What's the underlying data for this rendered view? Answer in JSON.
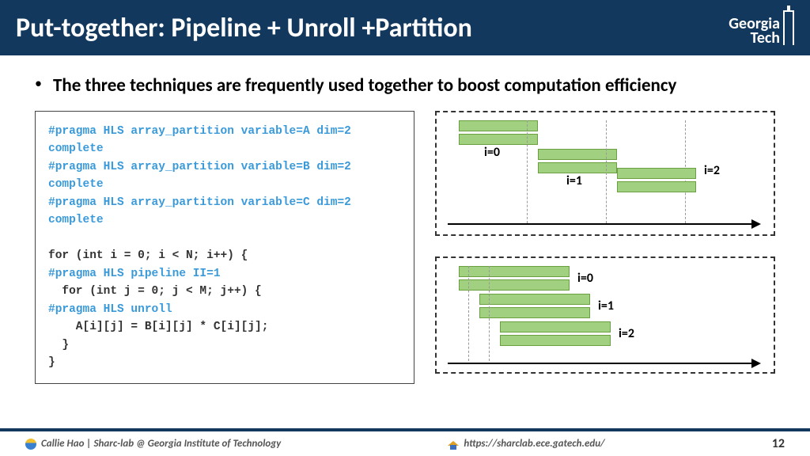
{
  "header": {
    "title": "Put-together: Pipeline + Unroll +Partition",
    "logo_l1": "Georgia",
    "logo_l2": "Tech"
  },
  "bullet": "The three techniques are frequently used together to boost computation efficiency",
  "code": {
    "p1": "#pragma HLS array_partition variable=A dim=2 complete",
    "p2": "#pragma HLS array_partition variable=B dim=2 complete",
    "p3": "#pragma HLS array_partition variable=C dim=2 complete",
    "l1": "for (int i = 0; i < N; i++) {",
    "p4": "#pragma HLS pipeline II=1",
    "l2": "  for (int j = 0; j < M; j++) {",
    "p5": "#pragma HLS unroll",
    "l3": "    A[i][j] = B[i][j] * C[i][j];",
    "l4": "  }",
    "l5": "}"
  },
  "diag": {
    "i0": "i=0",
    "i1": "i=1",
    "i2": "i=2"
  },
  "footer": {
    "author": "Callie Hao | Sharc-lab @ Georgia Institute of Technology",
    "url": "https://sharclab.ece.gatech.edu/",
    "page": "12"
  }
}
